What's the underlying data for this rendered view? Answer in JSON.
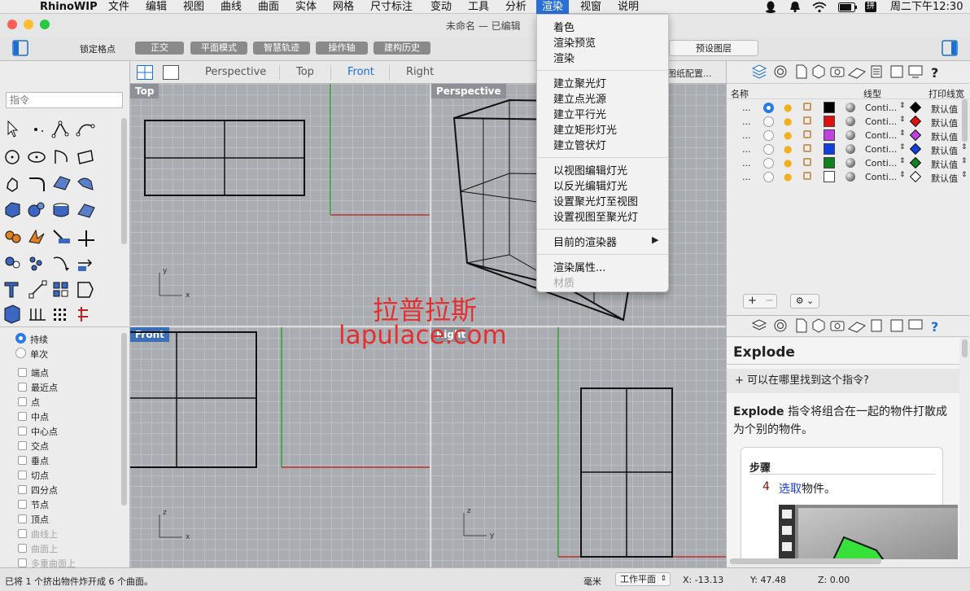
{
  "menubar": {
    "app": "RhinoWIP",
    "items": [
      "文件",
      "编辑",
      "视图",
      "曲线",
      "曲面",
      "实体",
      "网格",
      "尺寸标注",
      "变动",
      "工具",
      "分析",
      "渲染",
      "视窗",
      "说明"
    ],
    "active": "渲染",
    "clock": "周二下午12:30",
    "ime": "拼"
  },
  "window": {
    "title": "未命名 — 已编辑"
  },
  "toolbar": {
    "lock_grid": "锁定格点",
    "buttons": [
      "正交",
      "平面模式",
      "智慧轨迹",
      "操作轴",
      "建构历史"
    ],
    "layer_preset": "预设图层"
  },
  "viewport_tabs": [
    "Perspective",
    "Top",
    "Front",
    "Right"
  ],
  "active_tab": "Front",
  "paper_config": "图纸配置...",
  "viewports": {
    "top": "Top",
    "perspective": "Perspective",
    "front": "Front",
    "right": "Right"
  },
  "command": {
    "placeholder": "指令"
  },
  "snap": {
    "radio": [
      "持续",
      "单次"
    ],
    "options": [
      "端点",
      "最近点",
      "点",
      "中点",
      "中心点",
      "交点",
      "垂点",
      "切点",
      "四分点",
      "节点",
      "顶点"
    ],
    "disabled": [
      "曲线上",
      "曲面上",
      "多重曲面上"
    ]
  },
  "render_menu": {
    "group1": [
      "着色",
      "渲染预览",
      "渲染"
    ],
    "group2": [
      "建立聚光灯",
      "建立点光源",
      "建立平行光",
      "建立矩形灯光",
      "建立管状灯"
    ],
    "group3": [
      "以视图编辑灯光",
      "以反光编辑灯光",
      "设置聚光灯至视图",
      "设置视图至聚光灯"
    ],
    "group4": [
      "目前的渲染器"
    ],
    "group5": [
      "渲染属性..."
    ],
    "disabled": "材质"
  },
  "layers": {
    "headers": {
      "name": "名称",
      "linetype": "线型",
      "print_width": "打印线宽"
    },
    "rows": [
      {
        "name": "...",
        "color": "#000000",
        "linetype": "Conti...",
        "print": "默认值",
        "active": true
      },
      {
        "name": "...",
        "color": "#e01010",
        "linetype": "Conti...",
        "print": "默认值",
        "active": false
      },
      {
        "name": "...",
        "color": "#c040e0",
        "linetype": "Conti...",
        "print": "默认值",
        "active": false
      },
      {
        "name": "...",
        "color": "#1040e0",
        "linetype": "Conti...",
        "print": "默认值",
        "active": false
      },
      {
        "name": "...",
        "color": "#108020",
        "linetype": "Conti...",
        "print": "默认值",
        "active": false
      },
      {
        "name": "...",
        "color": "#ffffff",
        "linetype": "Conti...",
        "print": "默认值",
        "active": false
      }
    ]
  },
  "help": {
    "title": "Explode",
    "where": "+ 可以在哪里找到这个指令?",
    "desc_cmd": "Explode",
    "desc": " 指令将组合在一起的物件打散成为个别的物件。",
    "steps_title": "步骤",
    "step_num": "4",
    "step_link": "选取",
    "step_rest": "物件。"
  },
  "watermark": {
    "line1": "拉普拉斯",
    "line2": "lapulace.com"
  },
  "status": {
    "message": "已将 1 个挤出物件炸开成 6 个曲面。",
    "units": "毫米",
    "cplane": "工作平面",
    "x": "X: -13.13",
    "y": "Y: 47.48",
    "z": "Z: 0.00"
  }
}
